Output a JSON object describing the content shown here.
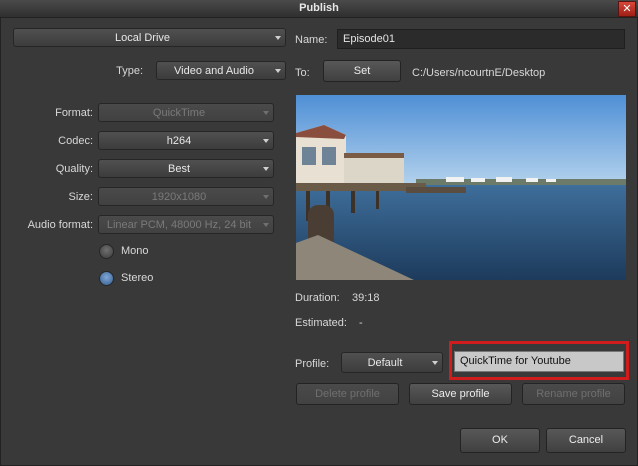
{
  "window": {
    "title": "Publish",
    "close_symbol": "✕"
  },
  "destination": {
    "selected": "Local Drive"
  },
  "type": {
    "label": "Type:",
    "selected": "Video and Audio"
  },
  "format": {
    "label": "Format:",
    "selected": "QuickTime",
    "disabled": true
  },
  "codec": {
    "label": "Codec:",
    "selected": "h264"
  },
  "quality": {
    "label": "Quality:",
    "selected": "Best"
  },
  "size": {
    "label": "Size:",
    "selected": "1920x1080",
    "disabled": true
  },
  "audio_format": {
    "label": "Audio format:",
    "selected": "Linear PCM, 48000 Hz, 24 bit",
    "disabled": true
  },
  "channels": {
    "mono_label": "Mono",
    "stereo_label": "Stereo",
    "selected": "Stereo"
  },
  "name": {
    "label": "Name:",
    "value": "Episode01"
  },
  "to": {
    "label": "To:",
    "set_label": "Set",
    "path": "C:/Users/ncourtnE/Desktop"
  },
  "info": {
    "duration_label": "Duration:",
    "duration_value": "39:18",
    "estimated_label": "Estimated:",
    "estimated_value": "-"
  },
  "profile": {
    "label": "Profile:",
    "selected": "Default",
    "name_value": "QuickTime for Youtube",
    "delete_label": "Delete profile",
    "save_label": "Save profile",
    "rename_label": "Rename profile"
  },
  "actions": {
    "ok_label": "OK",
    "cancel_label": "Cancel"
  },
  "colors": {
    "highlight": "#d01c1c",
    "bg": "#393939"
  }
}
